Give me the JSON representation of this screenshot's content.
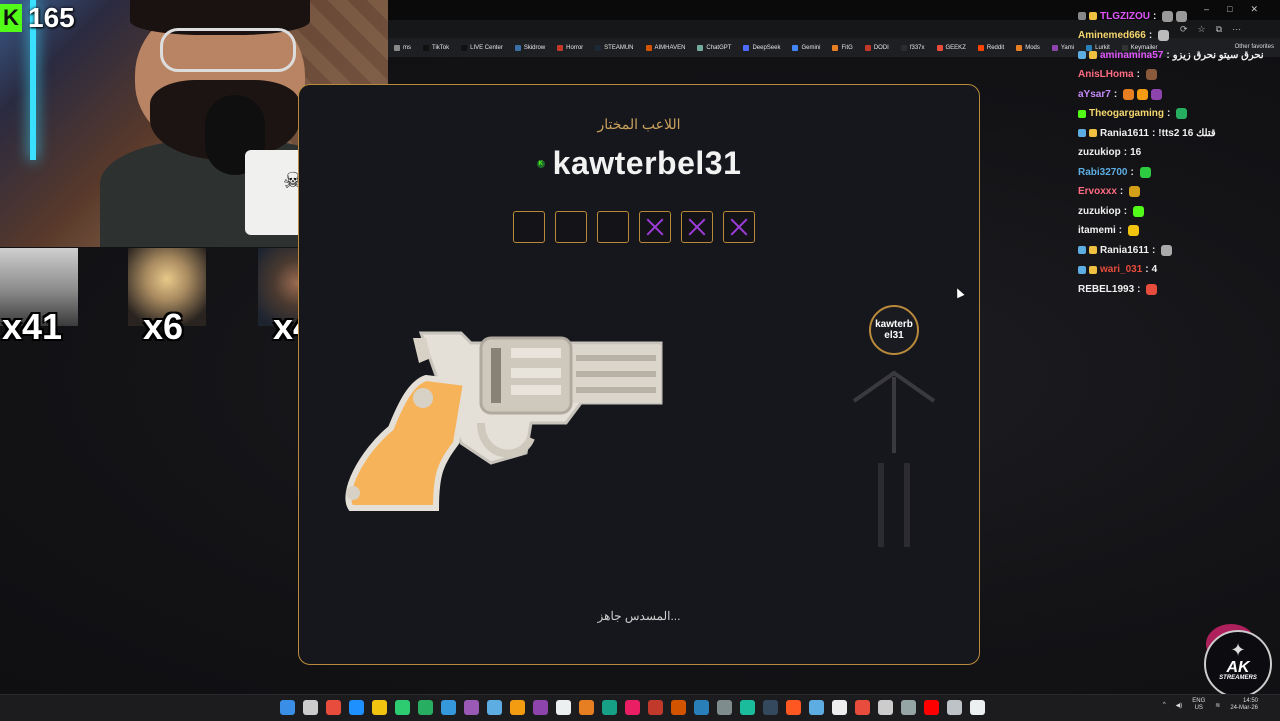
{
  "stream": {
    "kick_viewer_count": "165",
    "kick_logo": "K",
    "multipliers": [
      "x41",
      "x6",
      "x4"
    ]
  },
  "browser": {
    "bookmarks": [
      "ms",
      "TikTok",
      "LIVE Center",
      "Skidrow",
      "Horror",
      "STEAMUN",
      "AIMHAVEN",
      "ChatGPT",
      "DeepSeek",
      "Gemini",
      "FitG",
      "DODI",
      "f337x",
      "GEEKZ",
      "Reddit",
      "Mods",
      "Yami",
      "Lurkit",
      "Keymailer"
    ],
    "other_favorites": "Other favorites",
    "bookmark_colors": [
      "#888888",
      "#111111",
      "#111111",
      "#3a6ea5",
      "#c0392b",
      "#1b2838",
      "#d35400",
      "#74aa9c",
      "#4d6bfe",
      "#4285f4",
      "#e67e22",
      "#c0392b",
      "#2c2c2c",
      "#e74c3c",
      "#ff4500",
      "#e67e22",
      "#8e44ad",
      "#2980b9",
      "#333333"
    ]
  },
  "game": {
    "selected_label": "اللاعب المختار",
    "player_badge": "K",
    "player_name": "kawterbel31",
    "chambers": [
      false,
      false,
      false,
      true,
      true,
      true
    ],
    "target_name": "kawterbel31",
    "status": "المسدس جاهز..."
  },
  "chat": [
    {
      "user": "TLGZIZOU",
      "text": "",
      "color": "#e056fd",
      "badges": [
        "#888888",
        "#f0c040"
      ],
      "emotes": [
        "#999999",
        "#999999"
      ]
    },
    {
      "user": "Aminemed666",
      "text": "",
      "color": "#f5d76e",
      "badges": [],
      "emotes": [
        "#bbbbbb"
      ]
    },
    {
      "user": "aminamina57",
      "text": "نحرق سيتو نحرق زيزو",
      "color": "#e056fd",
      "badges": [
        "#5dade2",
        "#f0c040"
      ],
      "emotes": []
    },
    {
      "user": "AnisLHoma",
      "text": "",
      "color": "#ff6b81",
      "badges": [],
      "emotes": [
        "#8b5a3c"
      ]
    },
    {
      "user": "aYsar7",
      "text": "",
      "color": "#c58af9",
      "badges": [],
      "emotes": [
        "#e67e22",
        "#f39c12",
        "#8e44ad"
      ]
    },
    {
      "user": "Theogargaming",
      "text": "",
      "color": "#f5d76e",
      "badges": [
        "#53fc18"
      ],
      "emotes": [
        "#27ae60"
      ]
    },
    {
      "user": "Rania1611",
      "text": "!tts2 16 قتلك",
      "color": "#f0f0f0",
      "badges": [
        "#5dade2",
        "#f0c040"
      ],
      "emotes": []
    },
    {
      "user": "zuzukiop",
      "text": "16",
      "color": "#f0f0f0",
      "badges": [],
      "emotes": []
    },
    {
      "user": "Rabi32700",
      "text": "",
      "color": "#5dade2",
      "badges": [],
      "emotes": [
        "#2ecc40"
      ]
    },
    {
      "user": "Ervoxxx",
      "text": "",
      "color": "#ff6b81",
      "badges": [],
      "emotes": [
        "#d4a017"
      ]
    },
    {
      "user": "zuzukiop",
      "text": "",
      "color": "#f0f0f0",
      "badges": [],
      "emotes": [
        "#53fc18"
      ]
    },
    {
      "user": "itamemi",
      "text": "",
      "color": "#f0f0f0",
      "badges": [],
      "emotes": [
        "#f1c40f"
      ]
    },
    {
      "user": "Rania1611",
      "text": "",
      "color": "#f0f0f0",
      "badges": [
        "#5dade2",
        "#f0c040"
      ],
      "emotes": [
        "#aaaaaa"
      ]
    },
    {
      "user": "wari_031",
      "text": "4",
      "color": "#e74c3c",
      "badges": [
        "#5dade2",
        "#f0c040"
      ],
      "emotes": []
    },
    {
      "user": "REBEL1993",
      "text": "",
      "color": "#f0f0f0",
      "badges": [],
      "emotes": [
        "#e74c3c"
      ]
    }
  ],
  "overlay": {
    "logo_text": "AK",
    "logo_sub": "STREAMERS"
  },
  "taskbar": {
    "icon_colors": [
      "#3a8ee6",
      "#cccccc",
      "#e74c3c",
      "#1e90ff",
      "#f1c40f",
      "#2ecc71",
      "#27ae60",
      "#3498db",
      "#9b59b6",
      "#5dade2",
      "#f39c12",
      "#8e44ad",
      "#ecf0f1",
      "#e67e22",
      "#16a085",
      "#e91e63",
      "#c0392b",
      "#d35400",
      "#2980b9",
      "#7f8c8d",
      "#1abc9c",
      "#34495e",
      "#ff5722",
      "#5dade2",
      "#eeeeee",
      "#e74c3c",
      "#cccccc",
      "#95a5a6",
      "#ff0000",
      "#bdc3c7",
      "#ecf0f1"
    ],
    "lang_top": "ENG",
    "lang_bottom": "US",
    "time": "14:50",
    "date": "24-Mar-26"
  },
  "colors": {
    "accent_gold": "#b8893a",
    "fired_purple": "#9d3bd8",
    "kick_green": "#53fc18"
  }
}
